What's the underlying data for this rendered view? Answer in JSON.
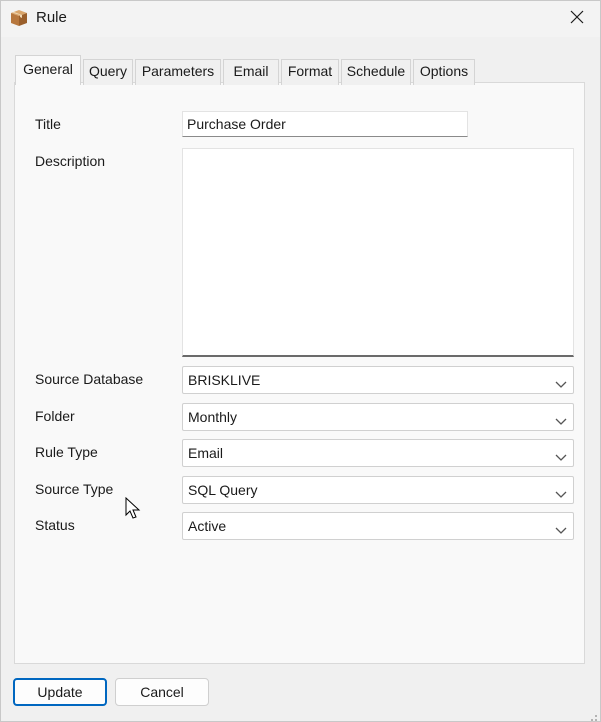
{
  "window": {
    "title": "Rule",
    "icon": "package-icon"
  },
  "tabs": [
    {
      "label": "General",
      "active": true
    },
    {
      "label": "Query",
      "active": false
    },
    {
      "label": "Parameters",
      "active": false
    },
    {
      "label": "Email",
      "active": false
    },
    {
      "label": "Format",
      "active": false
    },
    {
      "label": "Schedule",
      "active": false
    },
    {
      "label": "Options",
      "active": false
    }
  ],
  "form": {
    "title": {
      "label": "Title",
      "value": "Purchase Order"
    },
    "description": {
      "label": "Description",
      "value": ""
    },
    "source_database": {
      "label": "Source Database",
      "value": "BRISKLIVE"
    },
    "folder": {
      "label": "Folder",
      "value": "Monthly"
    },
    "rule_type": {
      "label": "Rule Type",
      "value": "Email"
    },
    "source_type": {
      "label": "Source Type",
      "value": "SQL Query"
    },
    "status": {
      "label": "Status",
      "value": "Active"
    }
  },
  "buttons": {
    "update": "Update",
    "cancel": "Cancel"
  },
  "colors": {
    "accent": "#0067c0",
    "panel": "#f9f9f9",
    "window": "#f0f0f0"
  }
}
